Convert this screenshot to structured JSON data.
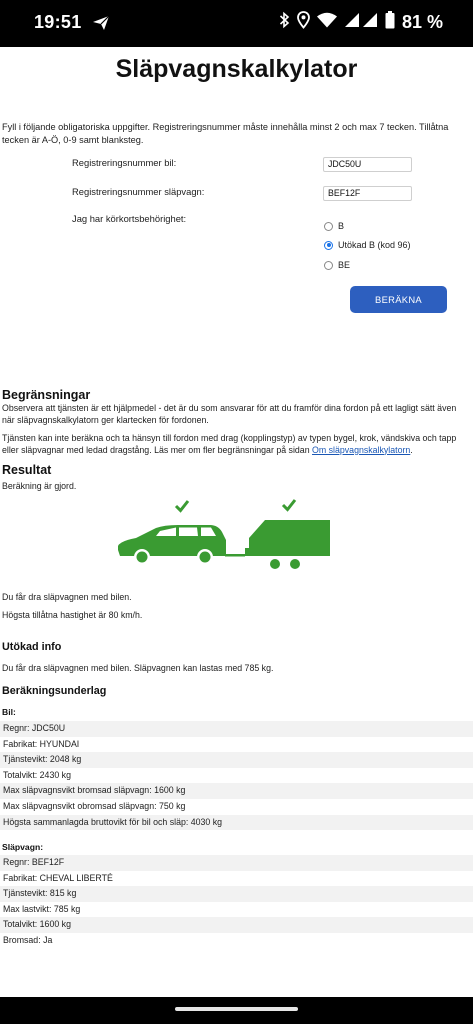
{
  "status_bar": {
    "time": "19:51",
    "battery_percent": "81 %",
    "icons": [
      "send-icon",
      "bluetooth-icon",
      "location-icon",
      "wifi-icon",
      "signal-icon",
      "battery-icon"
    ]
  },
  "page": {
    "title": "Släpvagnskalkylator",
    "intro": "Fyll i följande obligatoriska uppgifter. Registreringsnummer måste innehålla minst 2 och max 7 tecken. Tillåtna tecken är A-Ö, 0-9 samt blanksteg."
  },
  "form": {
    "car_reg_label": "Registreringsnummer bil:",
    "car_reg_value": "JDC50U",
    "trailer_reg_label": "Registreringsnummer släpvagn:",
    "trailer_reg_value": "BEF12F",
    "license_label": "Jag har körkortsbehörighet:",
    "license_options": [
      "B",
      "Utökad B (kod 96)",
      "BE"
    ],
    "license_selected": "Utökad B (kod 96)",
    "submit_label": "BERÄKNA"
  },
  "limitations": {
    "heading": "Begränsningar",
    "p1": "Observera att tjänsten är ett hjälpmedel - det är du som ansvarar för att du framför dina fordon på ett lagligt sätt även när släpvagnskalkylatorn ger klartecken för fordonen.",
    "p2_text": "Tjänsten kan inte beräkna och ta hänsyn till fordon med drag (kopplingstyp) av typen bygel, krok, vändskiva och tapp eller släpvagnar med ledad dragstång. Läs mer om fler begränsningar på sidan ",
    "p2_link": "Om släpvagnskalkylatorn",
    "p2_end": "."
  },
  "result": {
    "heading": "Resultat",
    "status": "Beräkning är gjord.",
    "message": "Du får dra släpvagnen med bilen.",
    "speed": "Högsta tillåtna hastighet är 80 km/h.",
    "colors": {
      "ok": "#3a9b32"
    }
  },
  "extended": {
    "heading": "Utökad info",
    "text": "Du får dra släpvagnen med bilen. Släpvagnen kan lastas med 785 kg."
  },
  "basis": {
    "heading": "Beräkningsunderlag",
    "car_heading": "Bil:",
    "car_rows": [
      "Regnr: JDC50U",
      "Fabrikat: HYUNDAI",
      "Tjänstevikt: 2048 kg",
      "Totalvikt: 2430 kg",
      "Max släpvagnsvikt bromsad släpvagn: 1600 kg",
      "Max släpvagnsvikt obromsad släpvagn: 750 kg",
      "Högsta sammanlagda bruttovikt för bil och släp: 4030 kg"
    ],
    "trailer_heading": "Släpvagn:",
    "trailer_rows": [
      "Regnr: BEF12F",
      "Fabrikat: CHEVAL LIBERTÉ",
      "Tjänstevikt: 815 kg",
      "Max lastvikt: 785 kg",
      "Totalvikt: 1600 kg",
      "Bromsad: Ja"
    ]
  }
}
